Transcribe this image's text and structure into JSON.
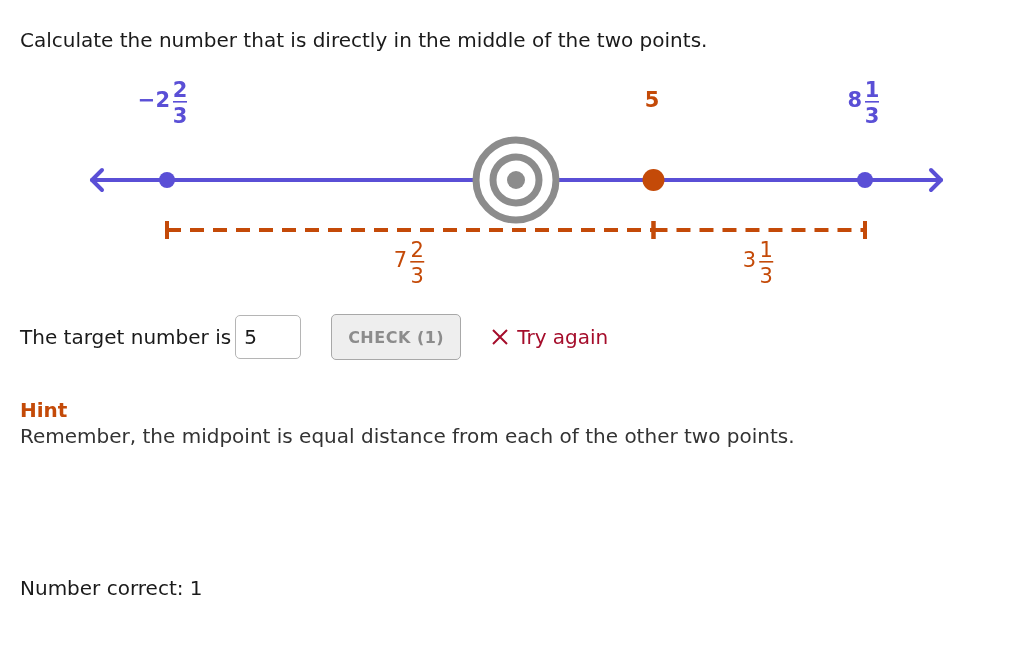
{
  "prompt": "Calculate the number that is directly in the middle of the two points.",
  "number_line": {
    "points": [
      {
        "whole": "−2",
        "numerator": "2",
        "denominator": "3",
        "kind": "given"
      },
      {
        "whole": "5",
        "kind": "guess"
      },
      {
        "whole": "8",
        "numerator": "1",
        "denominator": "3",
        "kind": "given"
      }
    ],
    "distances": [
      {
        "whole": "7",
        "numerator": "2",
        "denominator": "3"
      },
      {
        "whole": "3",
        "numerator": "1",
        "denominator": "3"
      }
    ]
  },
  "answer": {
    "label": "The target number is",
    "value": "5"
  },
  "check_button": {
    "label": "CHECK (1)",
    "disabled": true
  },
  "feedback": {
    "text": "Try again",
    "kind": "incorrect"
  },
  "hint": {
    "title": "Hint",
    "text": "Remember, the midpoint is equal distance from each of the other two points."
  },
  "score": "Number correct: 1"
}
